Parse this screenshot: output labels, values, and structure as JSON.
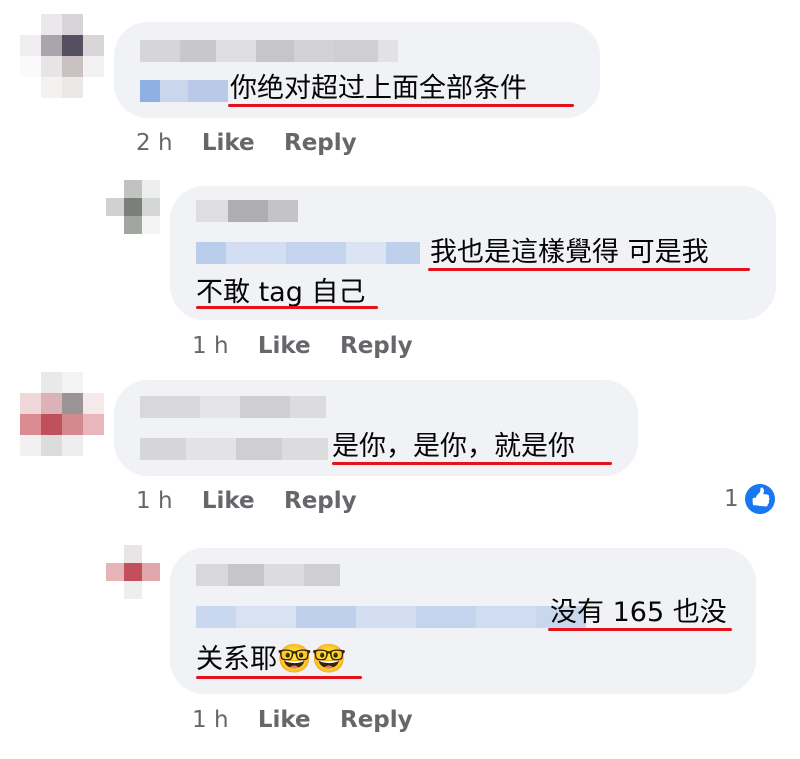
{
  "comments": [
    {
      "text_line1": "你绝对超过上面全部条件",
      "time": "2 h",
      "like": "Like",
      "reply": "Reply"
    },
    {
      "text_line1": "我也是這樣覺得 可是我",
      "text_line2": "不敢 tag 自己",
      "time": "1 h",
      "like": "Like",
      "reply": "Reply"
    },
    {
      "text_line1": "是你，是你，就是你",
      "time": "1 h",
      "like": "Like",
      "reply": "Reply",
      "reaction_count": "1",
      "reaction_icon": "thumbs-up-icon"
    },
    {
      "text_line1": "没有 165 也没",
      "text_line2": "关系耶",
      "emoji": "🤓🤓",
      "time": "1 h",
      "like": "Like",
      "reply": "Reply"
    }
  ],
  "colors": {
    "bubble": "#f0f2f5",
    "underline": "#e3121b",
    "meta": "#65676b",
    "like_blue": "#1877f2"
  }
}
